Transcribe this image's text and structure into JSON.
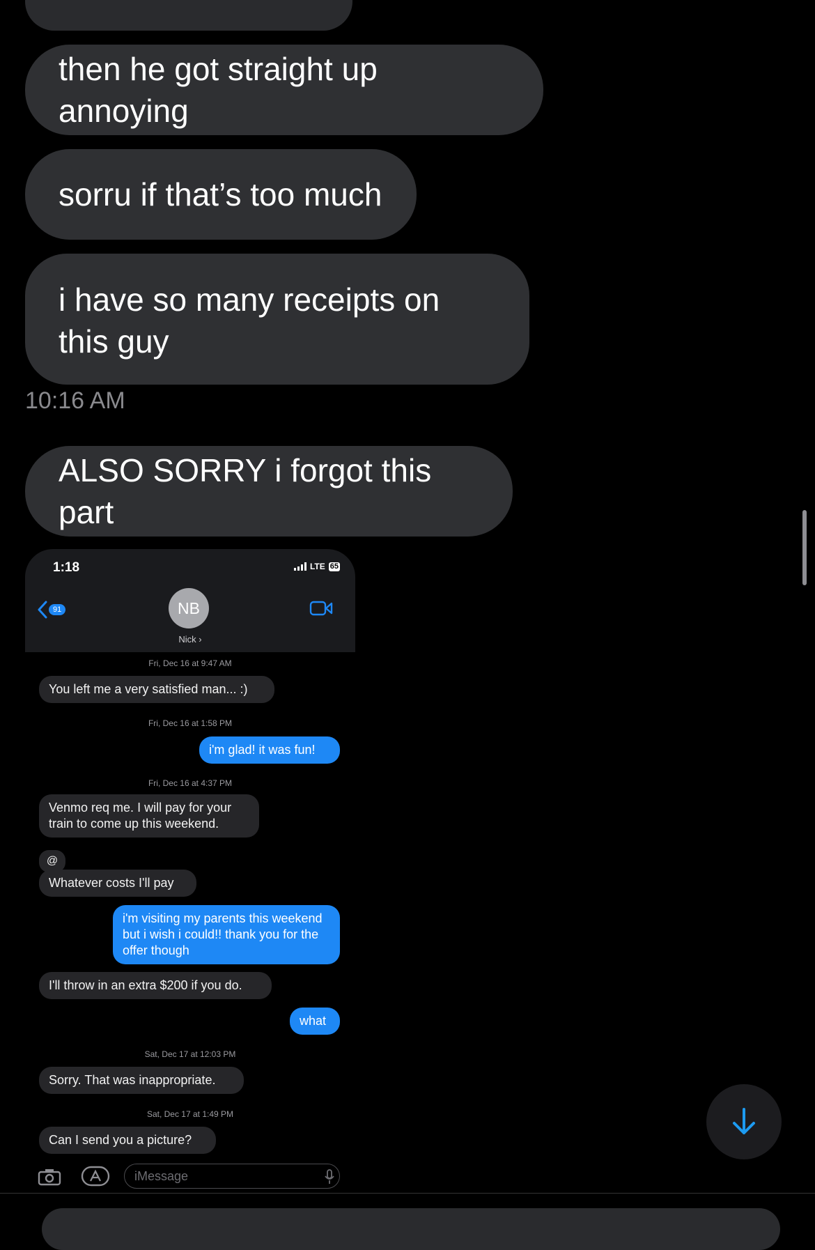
{
  "messages": [
    {
      "text": "then he got straight up annoying"
    },
    {
      "text": "sorru if that’s too much"
    },
    {
      "text": "i have so many receipts on this guy"
    },
    {
      "text": "ALSO SORRY i forgot this part"
    }
  ],
  "timestamp": "10:16 AM",
  "screenshot": {
    "status_time": "1:18",
    "network": "LTE",
    "battery": "65",
    "back_badge": "91",
    "avatar_initials": "NB",
    "contact_name": "Nick",
    "dates": [
      "Fri, Dec 16 at 9:47 AM",
      "Fri, Dec 16 at 1:58 PM",
      "Fri, Dec 16 at 4:37 PM",
      "Sat, Dec 17 at 12:03 PM",
      "Sat, Dec 17 at 1:49 PM"
    ],
    "msgs": [
      {
        "text": "You left me a very satisfied man... :)",
        "dir": "in"
      },
      {
        "text": "i'm glad! it was fun!",
        "dir": "out"
      },
      {
        "text": "Venmo req me. I will pay for your train to come up this weekend.",
        "dir": "in"
      },
      {
        "text": "@",
        "dir": "in"
      },
      {
        "text": "Whatever costs I'll pay",
        "dir": "in"
      },
      {
        "text": "i'm visiting my parents this weekend but i wish i could!! thank you for the offer though",
        "dir": "out"
      },
      {
        "text": "I'll throw in an extra $200 if you do.",
        "dir": "in"
      },
      {
        "text": "what",
        "dir": "out"
      },
      {
        "text": "Sorry. That was inappropriate.",
        "dir": "in"
      },
      {
        "text": "Can I send you a picture?",
        "dir": "in"
      }
    ],
    "input_placeholder": "iMessage"
  },
  "colors": {
    "incoming_bubble": "#2f3033",
    "blue": "#1e88f5"
  },
  "icons": [
    "chevron-left-icon",
    "video-icon",
    "camera-icon",
    "app-store-icon",
    "microphone-icon",
    "arrow-down-icon"
  ]
}
